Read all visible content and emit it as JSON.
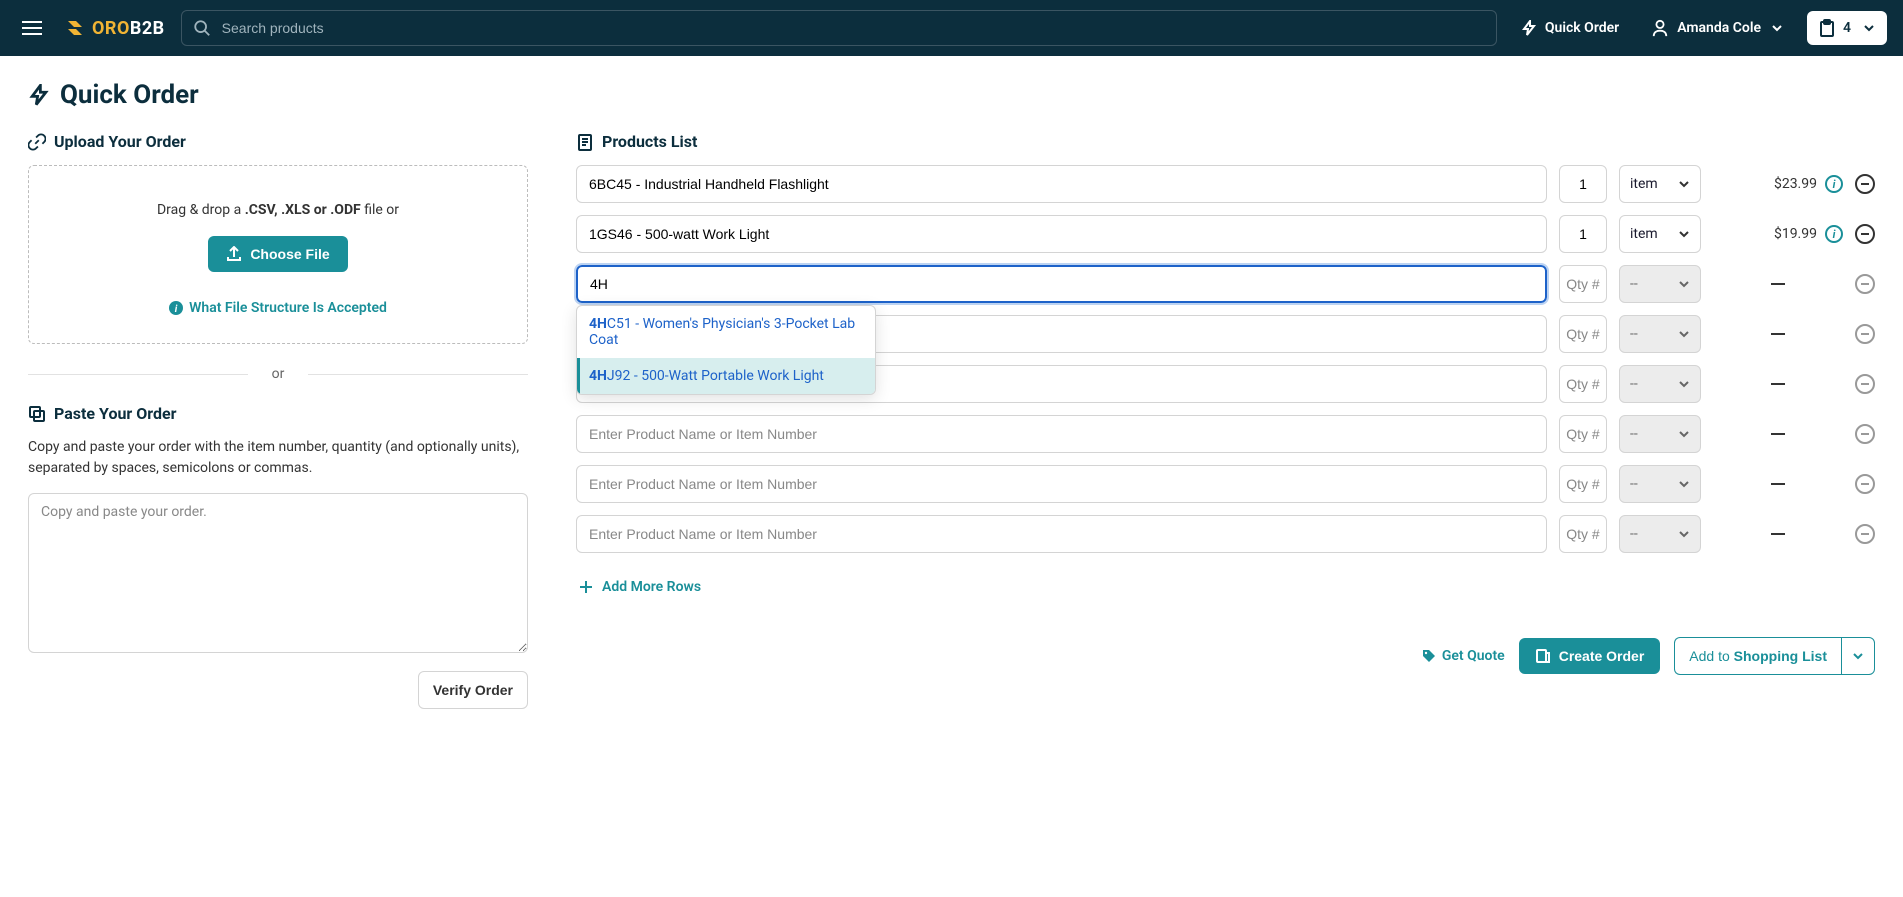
{
  "header": {
    "search_placeholder": "Search products",
    "quick_order": "Quick Order",
    "user_name": "Amanda Cole",
    "cart_count": "4"
  },
  "page": {
    "title": "Quick Order"
  },
  "upload": {
    "heading": "Upload Your Order",
    "hint_pre": "Drag & drop a ",
    "hint_ext": ".CSV, .XLS or .ODF",
    "hint_post": " file or",
    "choose_file": "Choose File",
    "help": "What File Structure Is Accepted",
    "or": "or"
  },
  "paste": {
    "heading": "Paste Your Order",
    "description": "Copy and paste your order with the item number, quantity (and optionally units), separated by spaces, semicolons or commas.",
    "placeholder": "Copy and paste your order.",
    "verify": "Verify Order"
  },
  "products": {
    "heading": "Products List",
    "placeholder_product": "Enter Product Name or Item Number",
    "placeholder_qty": "Qty #",
    "unit_item": "item",
    "unit_empty": "--",
    "rows": [
      {
        "product": "6BC45 - Industrial Handheld Flashlight",
        "qty": "1",
        "unit": "item",
        "price": "$23.99",
        "filled": true
      },
      {
        "product": "1GS46 - 500-watt Work Light",
        "qty": "1",
        "unit": "item",
        "price": "$19.99",
        "filled": true
      },
      {
        "product": "4H",
        "qty": "",
        "unit": "--",
        "price": "",
        "filled": false,
        "focused": true
      },
      {
        "product": "",
        "qty": "",
        "unit": "--",
        "price": "",
        "filled": false
      },
      {
        "product": "",
        "qty": "",
        "unit": "--",
        "price": "",
        "filled": false
      },
      {
        "product": "",
        "qty": "",
        "unit": "--",
        "price": "",
        "filled": false
      },
      {
        "product": "",
        "qty": "",
        "unit": "--",
        "price": "",
        "filled": false
      },
      {
        "product": "",
        "qty": "",
        "unit": "--",
        "price": "",
        "filled": false
      }
    ],
    "autocomplete": [
      {
        "match": "4H",
        "rest": "C51 - Women's Physician's 3-Pocket Lab Coat",
        "highlighted": false
      },
      {
        "match": "4H",
        "rest": "J92 - 500-Watt Portable Work Light",
        "highlighted": true
      }
    ],
    "add_more": "Add More Rows"
  },
  "actions": {
    "get_quote": "Get Quote",
    "create_order": "Create Order",
    "add_to": "Add to ",
    "shopping_list": "Shopping List"
  }
}
